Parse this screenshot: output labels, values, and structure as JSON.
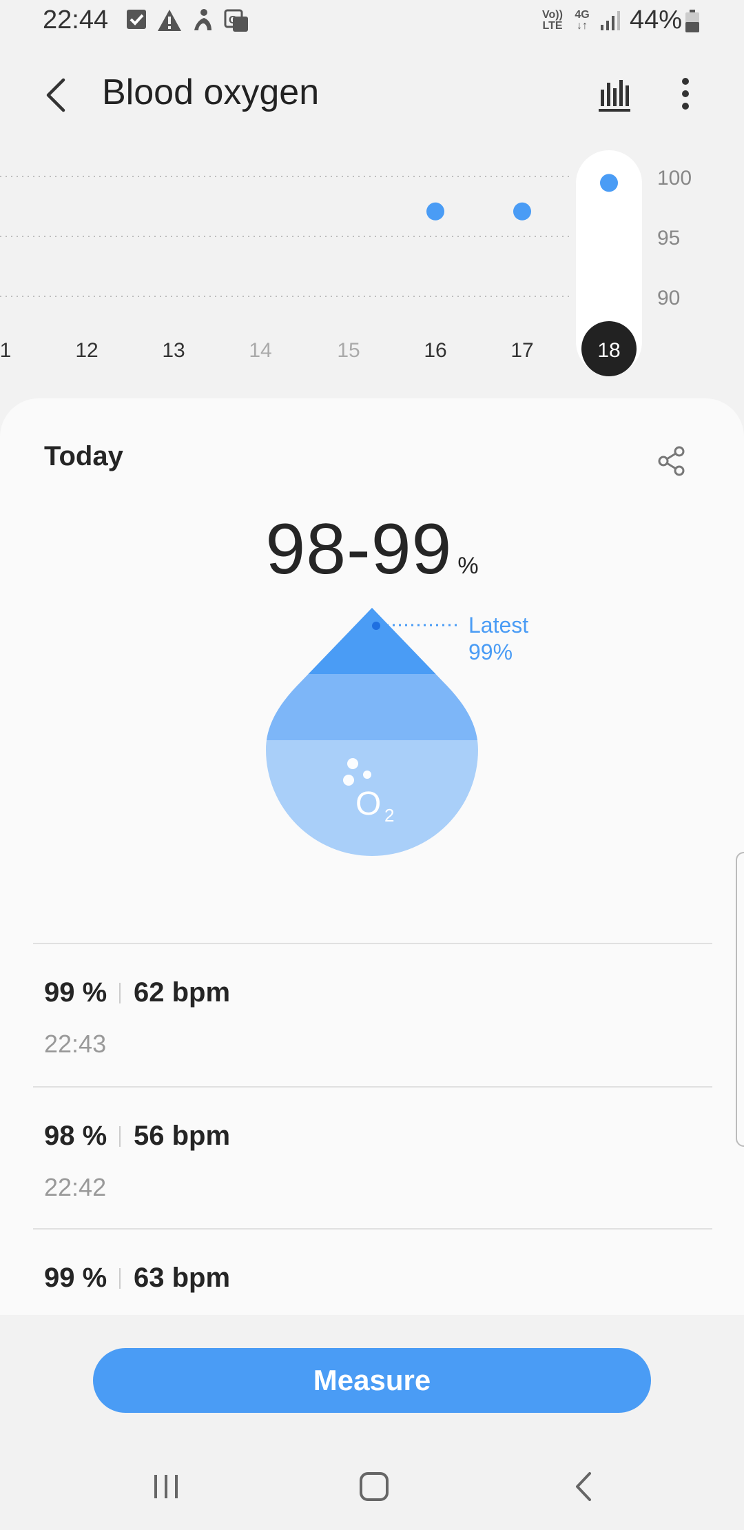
{
  "status_bar": {
    "time": "22:44",
    "volte_label_top": "Vo))",
    "volte_label_bottom": "LTE",
    "network": "4G",
    "battery": "44%"
  },
  "app_bar": {
    "title": "Blood oxygen",
    "back_icon": "chevron-left-icon",
    "chart_icon": "bar-chart-icon",
    "more_icon": "more-vert-icon"
  },
  "chart_data": {
    "type": "scatter",
    "x_labels": [
      "1",
      "12",
      "13",
      "14",
      "15",
      "16",
      "17",
      "18"
    ],
    "x_label_muted": [
      false,
      false,
      false,
      true,
      true,
      false,
      false,
      false
    ],
    "selected": "18",
    "y_ticks": [
      "100",
      "95",
      "90"
    ],
    "points": [
      {
        "x": "16",
        "y": 98
      },
      {
        "x": "17",
        "y": 98
      },
      {
        "x": "18",
        "y": 99
      }
    ],
    "ylim": [
      90,
      100
    ],
    "grid": true,
    "color": "#4a9cf5"
  },
  "summary": {
    "heading": "Today",
    "range": "98-99",
    "unit": "%",
    "latest_label": "Latest",
    "latest_value": "99%",
    "o2_symbol": "O",
    "o2_subscript": "2",
    "level_percent": 99
  },
  "readings": [
    {
      "spo2": "99 %",
      "bpm": "62 bpm",
      "time": "22:43"
    },
    {
      "spo2": "98 %",
      "bpm": "56 bpm",
      "time": "22:42"
    },
    {
      "spo2": "99 %",
      "bpm": "63 bpm",
      "time": ""
    }
  ],
  "measure_button": "Measure",
  "colors": {
    "accent": "#4a9cf5",
    "drop_dark": "#4a9cf5",
    "drop_mid": "#7db6f8",
    "drop_light": "#a9cff9",
    "selected_day": "#222222"
  }
}
